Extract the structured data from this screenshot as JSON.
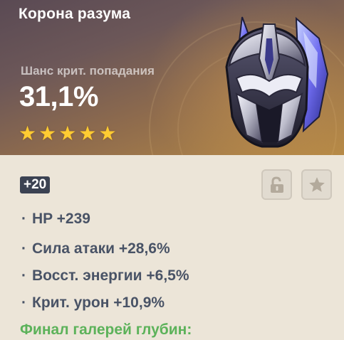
{
  "artifact": {
    "name": "Корона разума",
    "main_stat_label": "Шанс крит. попадания",
    "main_stat_value": "31,1%",
    "rarity": 5,
    "stars": [
      "★",
      "★",
      "★",
      "★",
      "★"
    ],
    "level": "+20",
    "set_name": "Финал галерей глубин:"
  },
  "substats": [
    {
      "bullet": "·",
      "text": "HP +239"
    },
    {
      "bullet": "·",
      "text": "Сила атаки +28,6%"
    },
    {
      "bullet": "·",
      "text": "Восст. энергии +6,5%"
    },
    {
      "bullet": "·",
      "text": "Крит. урон +10,9%"
    }
  ],
  "icons": {
    "lock": "unlocked-padlock-icon",
    "favorite": "star-icon",
    "artifact": "helmet-artifact-icon"
  },
  "colors": {
    "star": "#ffcc32",
    "substat_text": "#495366",
    "set_name": "#5cb25a",
    "level_badge_bg": "#3b4252",
    "panel_bg": "#ece5d8"
  }
}
